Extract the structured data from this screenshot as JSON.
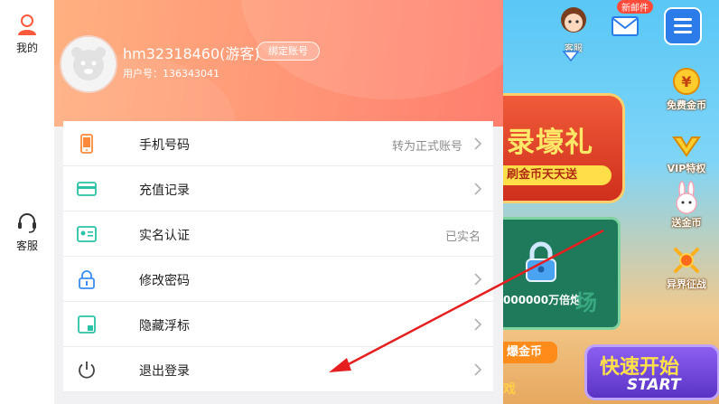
{
  "left_rail": {
    "mine_label": "我的",
    "service_label": "客服"
  },
  "profile": {
    "username": "hm32318460(游客)",
    "bind_button_label": "绑定账号",
    "user_id_label": "用户号：",
    "user_id": "136343041"
  },
  "menu": {
    "items": [
      {
        "label": "手机号码",
        "value": "转为正式账号",
        "icon": "phone-icon",
        "has_chevron": true
      },
      {
        "label": "充值记录",
        "value": "",
        "icon": "card-icon",
        "has_chevron": true
      },
      {
        "label": "实名认证",
        "value": "已实名",
        "icon": "id-card-icon",
        "has_chevron": false
      },
      {
        "label": "修改密码",
        "value": "",
        "icon": "lock-icon",
        "has_chevron": true
      },
      {
        "label": "隐藏浮标",
        "value": "",
        "icon": "float-icon",
        "has_chevron": true
      },
      {
        "label": "退出登录",
        "value": "",
        "icon": "power-icon",
        "has_chevron": true
      }
    ]
  },
  "game": {
    "service_label": "客服",
    "mail_badge": "新邮件",
    "banner_text": "录壕礼",
    "banner_sub": "刷金币天天送",
    "fish_text": "000000万倍炮",
    "fish_field": "场",
    "gold_tag": "爆金币",
    "gold_tag2": "戏",
    "start_cn": "快速开始",
    "start_en": "START",
    "side_features": [
      {
        "label": "免费金币",
        "icon": "free-coin-icon"
      },
      {
        "label": "VIP特权",
        "icon": "vip-icon"
      },
      {
        "label": "送金币",
        "icon": "rabbit-icon"
      },
      {
        "label": "异界征战",
        "icon": "war-icon"
      }
    ]
  },
  "colors": {
    "header_gradient_start": "#ffb081",
    "header_gradient_end": "#ff7e6e",
    "arrow": "#e51f1f",
    "icon_orange": "#ff8a3d",
    "icon_teal": "#2bc3a6",
    "icon_blue": "#3b8df2"
  }
}
